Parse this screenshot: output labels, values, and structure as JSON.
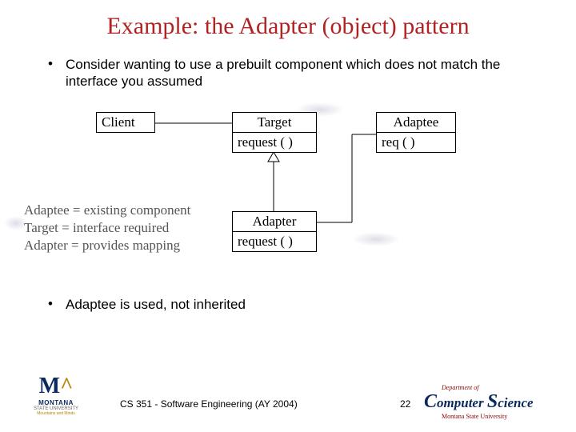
{
  "title": "Example: the Adapter (object) pattern",
  "bullets": {
    "b1": "Consider wanting to use a prebuilt component which does not match the interface you assumed",
    "b2": "Adaptee is used, not inherited"
  },
  "uml": {
    "client": {
      "name": "Client"
    },
    "target": {
      "name": "Target",
      "op": "request ( )"
    },
    "adaptee": {
      "name": "Adaptee",
      "op": "req ( )"
    },
    "adapter": {
      "name": "Adapter",
      "op": "request ( )"
    }
  },
  "notes": {
    "l1": "Adaptee = existing component",
    "l2": "Target = interface required",
    "l3": "Adapter = provides mapping"
  },
  "footer": {
    "course": "CS 351 - Software Engineering (AY 2004)",
    "page": "22",
    "left_logo": {
      "uni": "MONTANA",
      "state": "STATE UNIVERSITY",
      "tag": "Mountains and Minds"
    },
    "right_logo": {
      "dept": "Department of",
      "cs1": "Computer",
      "cs2": "Science",
      "msu": "Montana State University"
    }
  }
}
